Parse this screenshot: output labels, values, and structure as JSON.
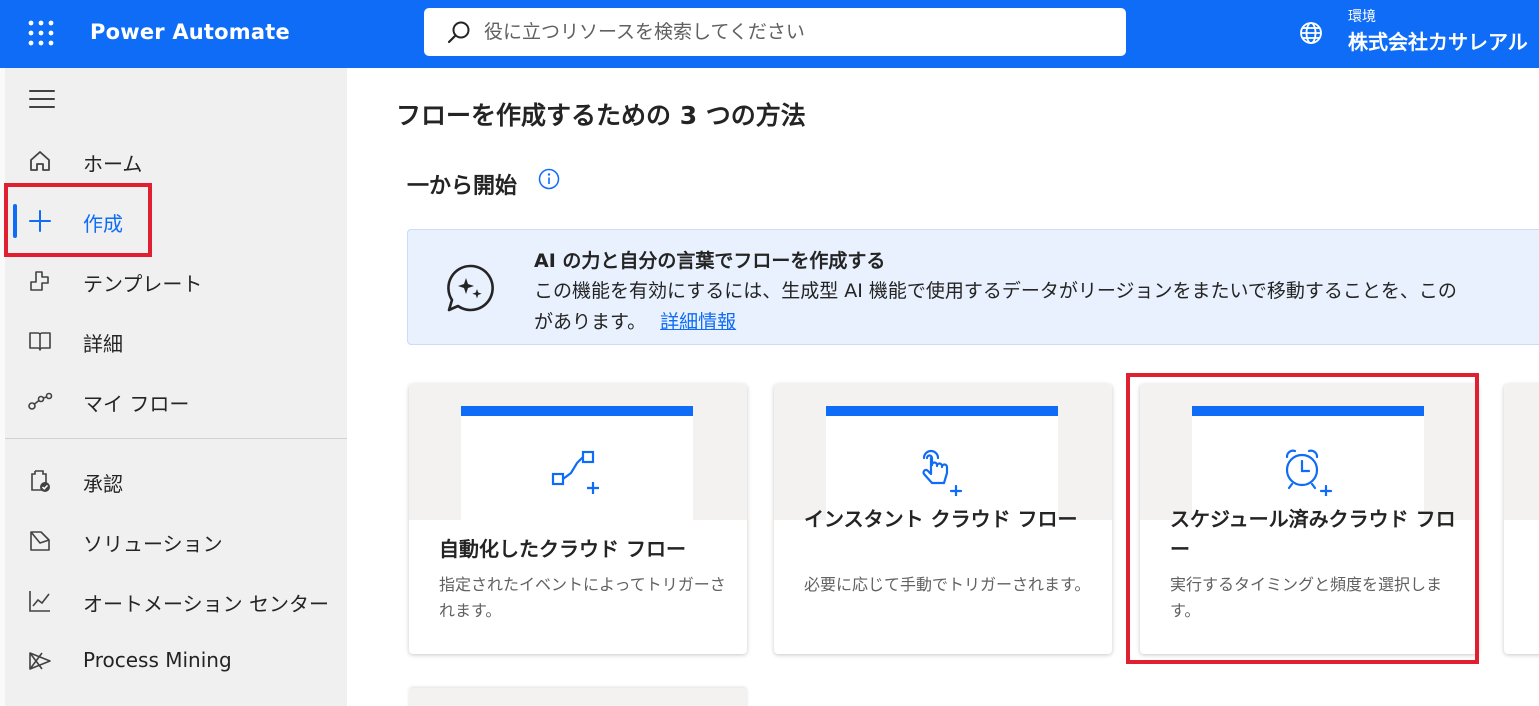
{
  "header": {
    "app_name": "Power Automate",
    "search_placeholder": "役に立つリソースを検索してください",
    "environment_label": "環境",
    "environment_name": "株式会社カサレアル"
  },
  "nav": {
    "items": [
      {
        "label": "ホーム",
        "icon": "home-icon"
      },
      {
        "label": "作成",
        "icon": "plus-icon"
      },
      {
        "label": "テンプレート",
        "icon": "template-icon"
      },
      {
        "label": "詳細",
        "icon": "book-icon"
      },
      {
        "label": "マイ フロー",
        "icon": "flow-icon"
      },
      {
        "label": "承認",
        "icon": "approval-icon"
      },
      {
        "label": "ソリューション",
        "icon": "solution-icon"
      },
      {
        "label": "オートメーション センター",
        "icon": "chart-icon"
      },
      {
        "label": "Process Mining",
        "icon": "process-mining-icon"
      }
    ],
    "active_index": 1
  },
  "main": {
    "page_title": "フローを作成するための 3 つの方法",
    "section_title": "一から開始",
    "banner": {
      "title": "AI の力と自分の言葉でフローを作成する",
      "text_line1": "この機能を有効にするには、生成型 AI 機能で使用するデータがリージョンをまたいで移動することを、この",
      "text_line2": "があります。",
      "link": "詳細情報"
    },
    "cards": [
      {
        "title": "自動化したクラウド フロー",
        "desc": "指定されたイベントによってトリガーされます。",
        "icon": "automated-flow-icon"
      },
      {
        "title": "インスタント クラウド フロー",
        "desc": "必要に応じて手動でトリガーされます。",
        "icon": "touch-icon"
      },
      {
        "title": "スケジュール済みクラウド フロー",
        "desc": "実行するタイミングと頻度を選択します。",
        "icon": "alarm-clock-icon"
      }
    ]
  },
  "colors": {
    "brand": "#0f6cf6",
    "highlight": "#e02030"
  }
}
